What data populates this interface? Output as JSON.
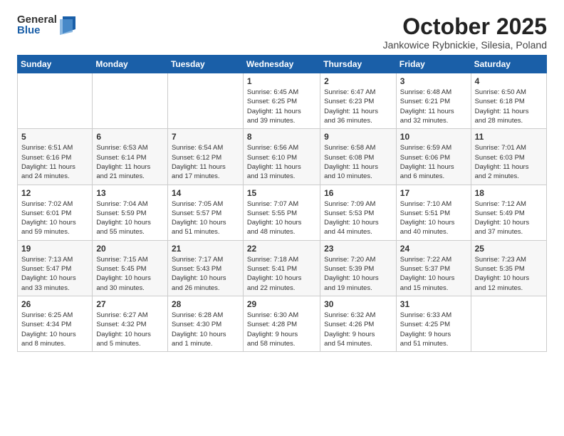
{
  "logo": {
    "general": "General",
    "blue": "Blue"
  },
  "title": "October 2025",
  "location": "Jankowice Rybnickie, Silesia, Poland",
  "weekdays": [
    "Sunday",
    "Monday",
    "Tuesday",
    "Wednesday",
    "Thursday",
    "Friday",
    "Saturday"
  ],
  "weeks": [
    [
      {
        "day": "",
        "info": ""
      },
      {
        "day": "",
        "info": ""
      },
      {
        "day": "",
        "info": ""
      },
      {
        "day": "1",
        "info": "Sunrise: 6:45 AM\nSunset: 6:25 PM\nDaylight: 11 hours\nand 39 minutes."
      },
      {
        "day": "2",
        "info": "Sunrise: 6:47 AM\nSunset: 6:23 PM\nDaylight: 11 hours\nand 36 minutes."
      },
      {
        "day": "3",
        "info": "Sunrise: 6:48 AM\nSunset: 6:21 PM\nDaylight: 11 hours\nand 32 minutes."
      },
      {
        "day": "4",
        "info": "Sunrise: 6:50 AM\nSunset: 6:18 PM\nDaylight: 11 hours\nand 28 minutes."
      }
    ],
    [
      {
        "day": "5",
        "info": "Sunrise: 6:51 AM\nSunset: 6:16 PM\nDaylight: 11 hours\nand 24 minutes."
      },
      {
        "day": "6",
        "info": "Sunrise: 6:53 AM\nSunset: 6:14 PM\nDaylight: 11 hours\nand 21 minutes."
      },
      {
        "day": "7",
        "info": "Sunrise: 6:54 AM\nSunset: 6:12 PM\nDaylight: 11 hours\nand 17 minutes."
      },
      {
        "day": "8",
        "info": "Sunrise: 6:56 AM\nSunset: 6:10 PM\nDaylight: 11 hours\nand 13 minutes."
      },
      {
        "day": "9",
        "info": "Sunrise: 6:58 AM\nSunset: 6:08 PM\nDaylight: 11 hours\nand 10 minutes."
      },
      {
        "day": "10",
        "info": "Sunrise: 6:59 AM\nSunset: 6:06 PM\nDaylight: 11 hours\nand 6 minutes."
      },
      {
        "day": "11",
        "info": "Sunrise: 7:01 AM\nSunset: 6:03 PM\nDaylight: 11 hours\nand 2 minutes."
      }
    ],
    [
      {
        "day": "12",
        "info": "Sunrise: 7:02 AM\nSunset: 6:01 PM\nDaylight: 10 hours\nand 59 minutes."
      },
      {
        "day": "13",
        "info": "Sunrise: 7:04 AM\nSunset: 5:59 PM\nDaylight: 10 hours\nand 55 minutes."
      },
      {
        "day": "14",
        "info": "Sunrise: 7:05 AM\nSunset: 5:57 PM\nDaylight: 10 hours\nand 51 minutes."
      },
      {
        "day": "15",
        "info": "Sunrise: 7:07 AM\nSunset: 5:55 PM\nDaylight: 10 hours\nand 48 minutes."
      },
      {
        "day": "16",
        "info": "Sunrise: 7:09 AM\nSunset: 5:53 PM\nDaylight: 10 hours\nand 44 minutes."
      },
      {
        "day": "17",
        "info": "Sunrise: 7:10 AM\nSunset: 5:51 PM\nDaylight: 10 hours\nand 40 minutes."
      },
      {
        "day": "18",
        "info": "Sunrise: 7:12 AM\nSunset: 5:49 PM\nDaylight: 10 hours\nand 37 minutes."
      }
    ],
    [
      {
        "day": "19",
        "info": "Sunrise: 7:13 AM\nSunset: 5:47 PM\nDaylight: 10 hours\nand 33 minutes."
      },
      {
        "day": "20",
        "info": "Sunrise: 7:15 AM\nSunset: 5:45 PM\nDaylight: 10 hours\nand 30 minutes."
      },
      {
        "day": "21",
        "info": "Sunrise: 7:17 AM\nSunset: 5:43 PM\nDaylight: 10 hours\nand 26 minutes."
      },
      {
        "day": "22",
        "info": "Sunrise: 7:18 AM\nSunset: 5:41 PM\nDaylight: 10 hours\nand 22 minutes."
      },
      {
        "day": "23",
        "info": "Sunrise: 7:20 AM\nSunset: 5:39 PM\nDaylight: 10 hours\nand 19 minutes."
      },
      {
        "day": "24",
        "info": "Sunrise: 7:22 AM\nSunset: 5:37 PM\nDaylight: 10 hours\nand 15 minutes."
      },
      {
        "day": "25",
        "info": "Sunrise: 7:23 AM\nSunset: 5:35 PM\nDaylight: 10 hours\nand 12 minutes."
      }
    ],
    [
      {
        "day": "26",
        "info": "Sunrise: 6:25 AM\nSunset: 4:34 PM\nDaylight: 10 hours\nand 8 minutes."
      },
      {
        "day": "27",
        "info": "Sunrise: 6:27 AM\nSunset: 4:32 PM\nDaylight: 10 hours\nand 5 minutes."
      },
      {
        "day": "28",
        "info": "Sunrise: 6:28 AM\nSunset: 4:30 PM\nDaylight: 10 hours\nand 1 minute."
      },
      {
        "day": "29",
        "info": "Sunrise: 6:30 AM\nSunset: 4:28 PM\nDaylight: 9 hours\nand 58 minutes."
      },
      {
        "day": "30",
        "info": "Sunrise: 6:32 AM\nSunset: 4:26 PM\nDaylight: 9 hours\nand 54 minutes."
      },
      {
        "day": "31",
        "info": "Sunrise: 6:33 AM\nSunset: 4:25 PM\nDaylight: 9 hours\nand 51 minutes."
      },
      {
        "day": "",
        "info": ""
      }
    ]
  ]
}
